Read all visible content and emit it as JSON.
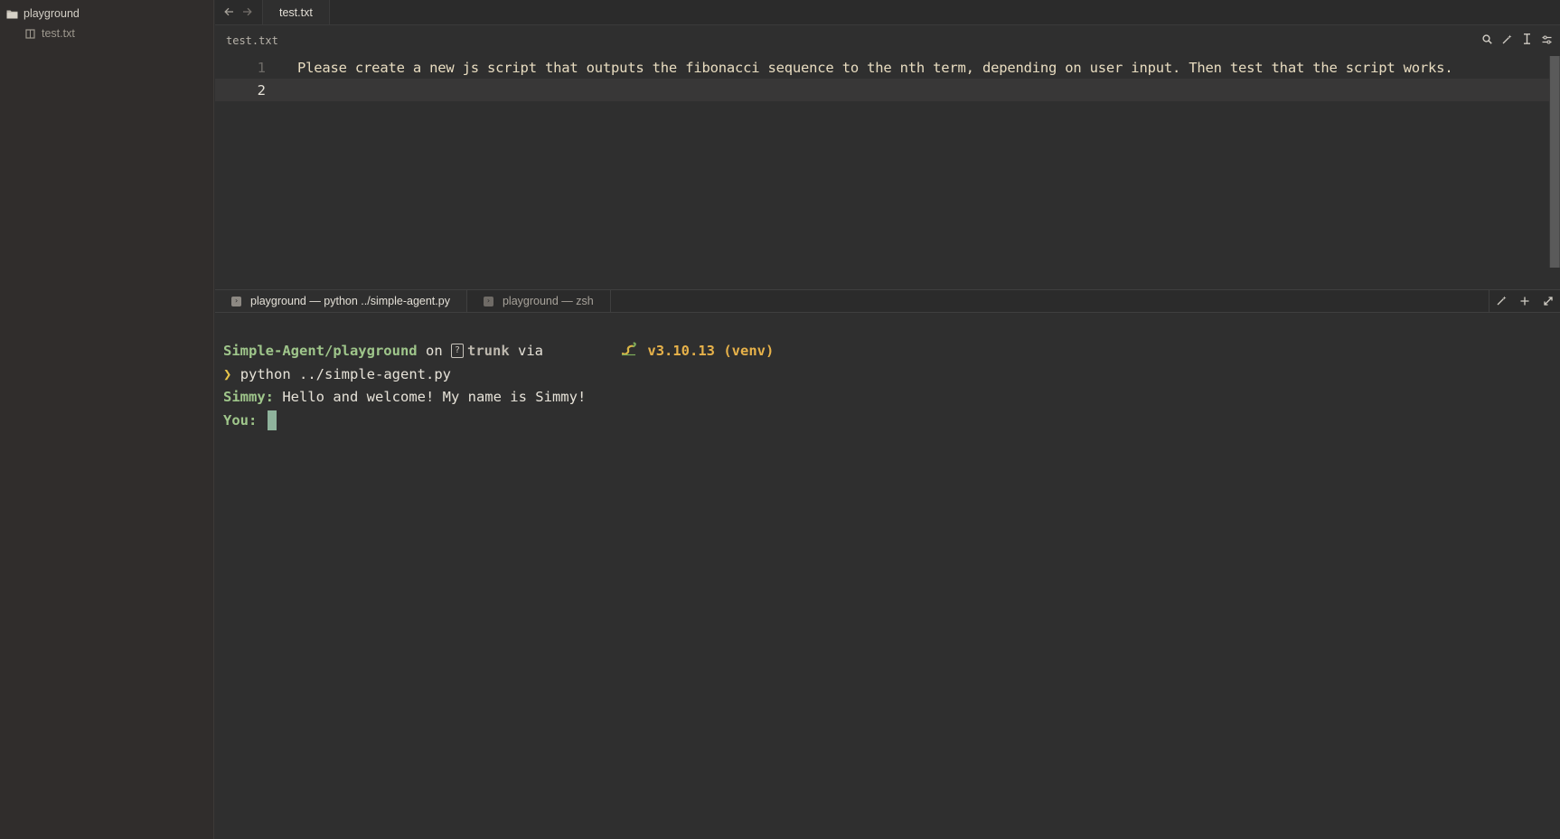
{
  "sidebar": {
    "root_folder": "playground",
    "files": [
      {
        "name": "test.txt"
      }
    ]
  },
  "editor": {
    "tab_label": "test.txt",
    "breadcrumb": "test.txt",
    "lines": [
      {
        "number": "1",
        "text": "Please create a new js script that outputs the fibonacci sequence to the nth term, depending on user input. Then test that the script works."
      },
      {
        "number": "2",
        "text": ""
      }
    ]
  },
  "terminal": {
    "tabs": [
      {
        "label": "playground — python ../simple-agent.py"
      },
      {
        "label": "playground — zsh"
      }
    ],
    "prompt_path": "Simple-Agent/playground",
    "on_word": "on",
    "branch": "trunk",
    "via_word": "via",
    "python_version": "v3.10.13 (venv)",
    "prompt_symbol": "❯",
    "command": "python ../simple-agent.py",
    "agent_label": "Simmy:",
    "agent_message": "Hello and welcome! My name is Simmy!",
    "user_label": "You:"
  },
  "icons": {
    "folder": "folder-icon",
    "file": "book-icon",
    "back": "arrow-left-icon",
    "forward": "arrow-right-icon",
    "search": "search-icon",
    "magic": "wand-icon",
    "cursor": "text-cursor-icon",
    "settings": "sliders-icon",
    "terminal": "terminal-icon",
    "plus": "plus-icon",
    "expand": "expand-icon"
  },
  "colors": {
    "background": "#2f2f2f",
    "sidebar": "#302d2c",
    "editor_text": "#e8dcc0",
    "prompt_green": "#9fc68b",
    "version_yellow": "#e7b24a",
    "cursor": "#8fb39c"
  }
}
